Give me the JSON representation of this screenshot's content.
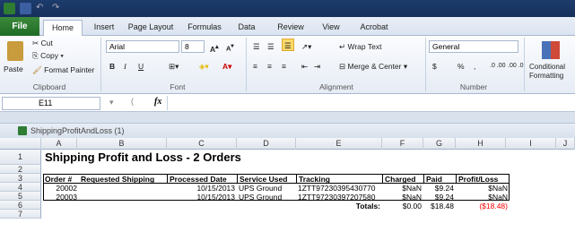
{
  "tabs": [
    "File",
    "Home",
    "Insert",
    "Page Layout",
    "Formulas",
    "Data",
    "Review",
    "View",
    "Acrobat"
  ],
  "clipboard": {
    "paste": "Paste",
    "cut": "Cut",
    "copy": "Copy",
    "format_painter": "Format Painter",
    "label": "Clipboard"
  },
  "font": {
    "name": "Arial",
    "size": "8",
    "label": "Font",
    "bold": "B",
    "italic": "I",
    "underline": "U"
  },
  "alignment": {
    "wrap": "Wrap Text",
    "merge": "Merge & Center",
    "label": "Alignment"
  },
  "number": {
    "format": "General",
    "dollar": "$",
    "percent": "%",
    "comma": ",",
    "inc": ".0 .00",
    "dec": ".00 .0",
    "label": "Number"
  },
  "styles": {
    "conditional": "Conditional",
    "formatting": "Formatting"
  },
  "formula_bar": {
    "namebox": "E11",
    "fx": "fx",
    "value": ""
  },
  "workbook": {
    "title": "ShippingProfitAndLoss (1)"
  },
  "columns": [
    "A",
    "B",
    "C",
    "D",
    "E",
    "F",
    "G",
    "H",
    "I",
    "J"
  ],
  "rows": [
    "1",
    "2",
    "3",
    "4",
    "5",
    "6",
    "7"
  ],
  "sheet": {
    "title": "Shipping Profit and Loss - 2 Orders",
    "headers": [
      "Order #",
      "Requested Shipping",
      "Processed Date",
      "Service Used",
      "Tracking",
      "Charged",
      "Paid",
      "Profit/Loss"
    ],
    "data": [
      [
        "20002",
        "",
        "10/15/2013",
        "UPS Ground",
        "1ZTT97230395430770",
        "$NaN",
        "$9.24",
        "$NaN"
      ],
      [
        "20003",
        "",
        "10/15/2013",
        "UPS Ground",
        "1ZTT97230397207580",
        "$NaN",
        "$9.24",
        "$NaN"
      ]
    ],
    "totals": {
      "label": "Totals:",
      "charged": "$0.00",
      "paid": "$18.48",
      "profit": "($18.48)"
    }
  },
  "colors": {
    "negative": "#ff0000",
    "file_tab": "#2a7a30",
    "title_bar": "#1d3c6c"
  }
}
